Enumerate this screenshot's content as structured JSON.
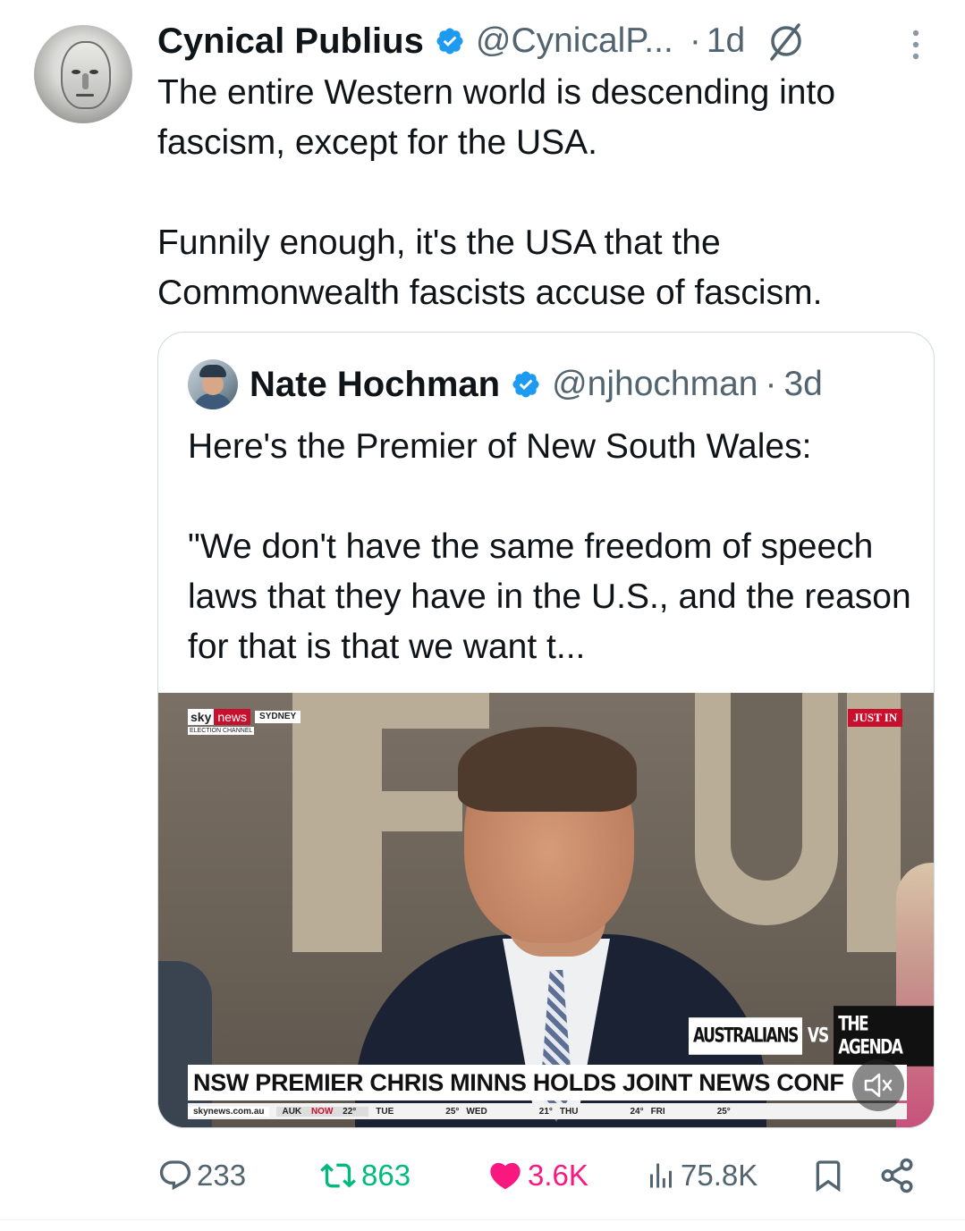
{
  "tweet": {
    "author_name": "Cynical Publius",
    "handle": "@CynicalP...",
    "separator": "·",
    "time": "1d",
    "text_paragraphs": [
      "The entire Western world is descending into fascism, except for the USA.",
      "Funnily enough, it's the USA that the Commonwealth fascists accuse of fascism."
    ]
  },
  "quote": {
    "author_name": "Nate Hochman",
    "handle": "@njhochman",
    "separator": "·",
    "time": "3d",
    "text_paragraphs": [
      "Here's the Premier of New South Wales:",
      "\"We don't have the same freedom of speech laws that they have in the U.S., and the reason for that is that we want t..."
    ],
    "video": {
      "channel_sky": "sky",
      "channel_news": "news",
      "location": "SYDNEY",
      "sub_channel": "ELECTION CHANNEL",
      "just_in": "JUST IN",
      "segment_left": "AUSTRALIANS",
      "segment_vs": "VS",
      "segment_right": "THE AGENDA",
      "headline": "NSW PREMIER CHRIS MINNS HOLDS JOINT NEWS CONF",
      "ticker_site": "skynews.com.au",
      "ticker_auk": "AUK",
      "ticker_now": "NOW",
      "ticker_temp_now": "22°",
      "ticker_items": [
        "TUE",
        "25°",
        "WED",
        "21°",
        "THU",
        "24°",
        "FRI",
        "25°"
      ]
    }
  },
  "actions": {
    "replies": "233",
    "retweets": "863",
    "likes": "3.6K",
    "views": "75.8K"
  },
  "colors": {
    "verified": "#1d9bf0",
    "secondary_text": "#536471",
    "retweet": "#00ba7c",
    "like": "#f91880",
    "news_red": "#c8102e"
  },
  "icons": [
    "verified-badge-icon",
    "grok-icon",
    "more-icon",
    "reply-icon",
    "retweet-icon",
    "like-icon",
    "views-icon",
    "bookmark-icon",
    "share-icon",
    "mute-icon"
  ]
}
